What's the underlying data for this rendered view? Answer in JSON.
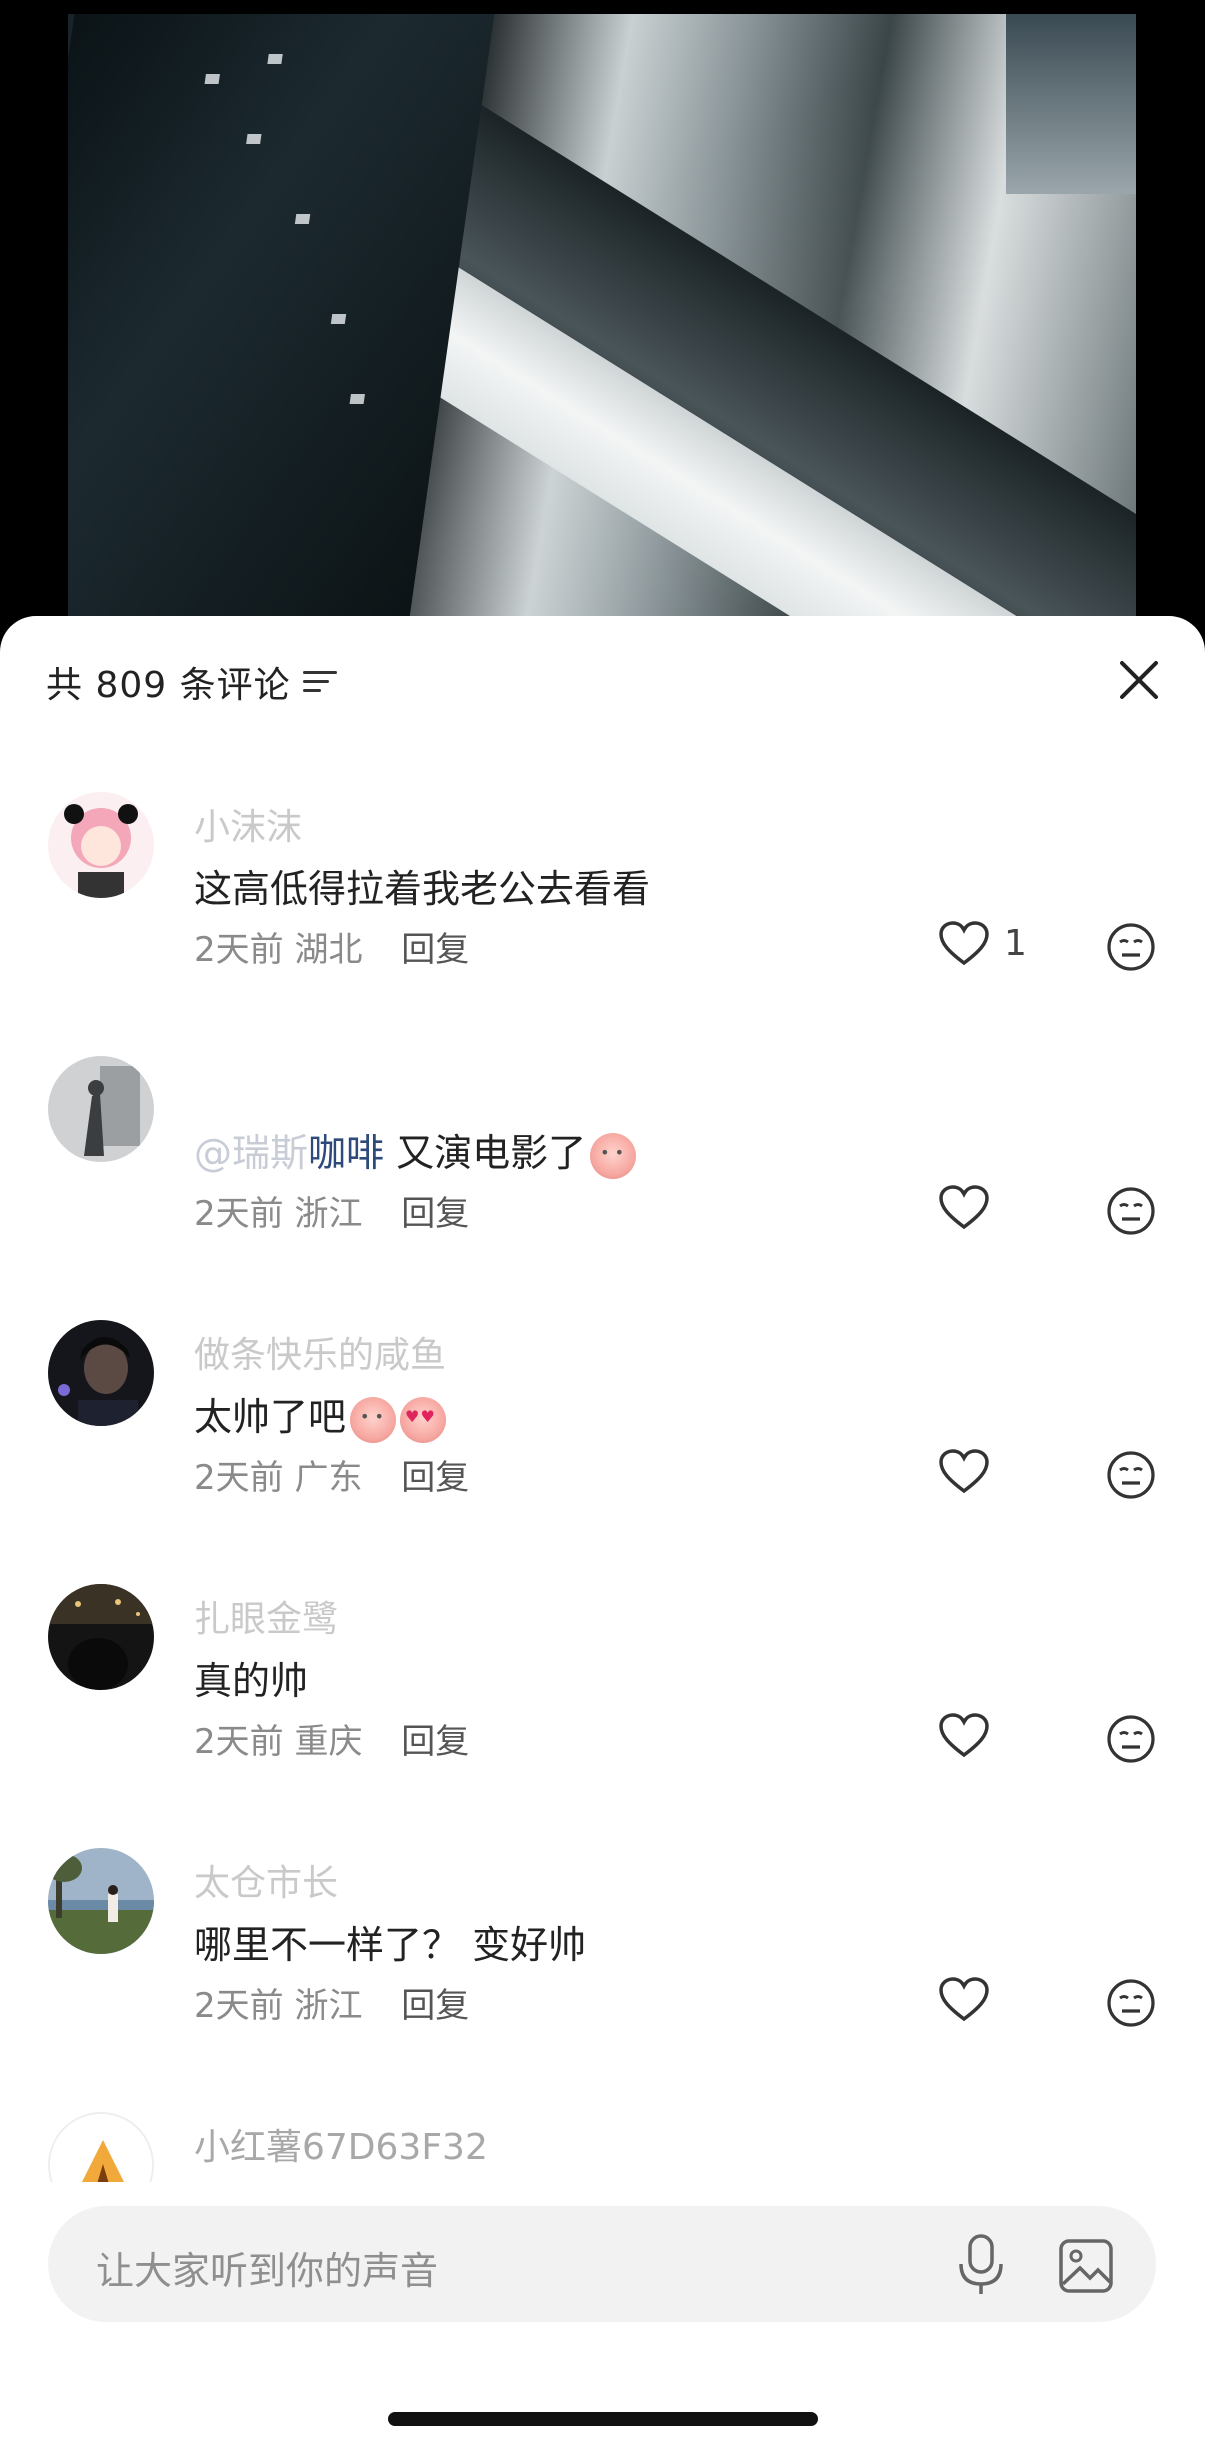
{
  "header": {
    "count_label": "共 809 条评论"
  },
  "comments": [
    {
      "username": "小沫沫",
      "text": "这高低得拉着我老公去看看",
      "time": "2天前",
      "location": "湖北",
      "reply_label": "回复",
      "likes": "1",
      "avatar": "anime-girl-pink-hair"
    },
    {
      "username": "",
      "mention": "@瑞斯",
      "mention_tail": "咖啡",
      "text": " 又演电影了",
      "emojis": [
        "blush-emoji"
      ],
      "time": "2天前",
      "location": "浙江",
      "reply_label": "回复",
      "likes": "",
      "avatar": "silhouette-photo"
    },
    {
      "username": "做条快乐的咸鱼",
      "text": "太帅了吧",
      "emojis": [
        "teary-emoji",
        "heart-eyes-emoji"
      ],
      "time": "2天前",
      "location": "广东",
      "reply_label": "回复",
      "likes": "",
      "avatar": "young-man-photo"
    },
    {
      "username": "扎眼金鹭",
      "text": "真的帅",
      "time": "2天前",
      "location": "重庆",
      "reply_label": "回复",
      "likes": "",
      "avatar": "night-city-photo"
    },
    {
      "username": "太仓市长",
      "text": "哪里不一样了？ 变好帅",
      "time": "2天前",
      "location": "浙江",
      "reply_label": "回复",
      "likes": "",
      "avatar": "outdoor-girl-photo"
    },
    {
      "username": "小红薯67D63F32",
      "avatar": "tent-default-avatar"
    }
  ],
  "input": {
    "placeholder": "让大家听到你的声音"
  },
  "icons": {
    "filter": "sort-icon",
    "close": "close-icon",
    "like": "heart-icon",
    "emoji": "emoji-icon",
    "mic": "microphone-icon",
    "image": "image-icon"
  }
}
